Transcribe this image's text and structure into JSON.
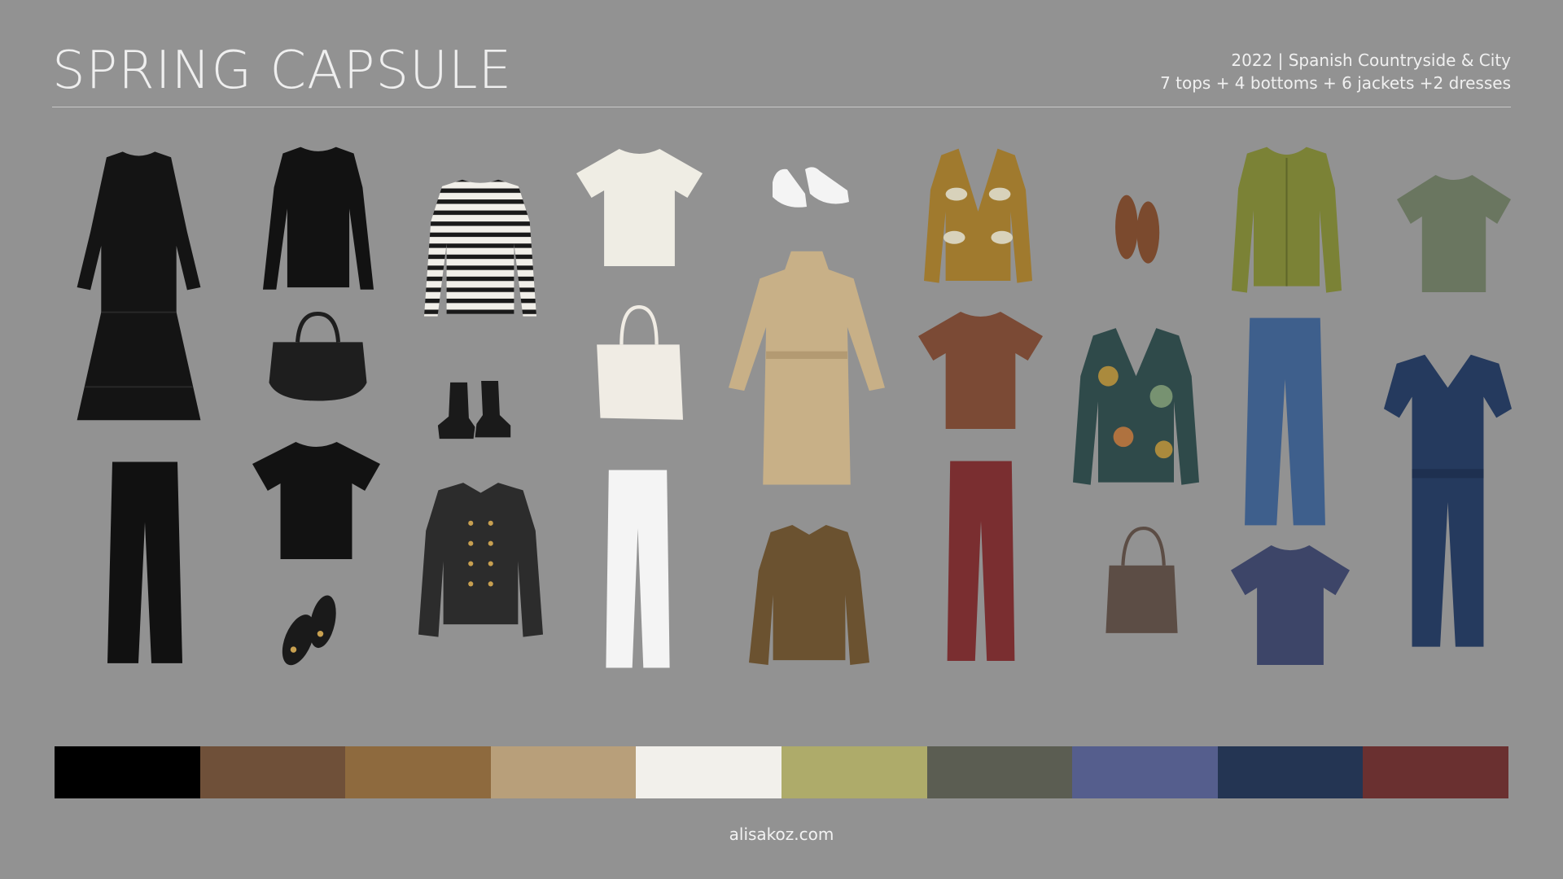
{
  "header": {
    "title": "SPRING CAPSULE",
    "subtitle_line1": "2022 | Spanish Countryside & City",
    "subtitle_line2": "7 tops + 4 bottoms + 6 jackets +2  dresses"
  },
  "items": [
    {
      "name": "black-dress-icon",
      "color": "#141414"
    },
    {
      "name": "black-pants-icon",
      "color": "#111111"
    },
    {
      "name": "black-longsleeve-top-icon",
      "color": "#121212"
    },
    {
      "name": "black-tote-bag-icon",
      "color": "#1e1e1e"
    },
    {
      "name": "black-tshirt-icon",
      "color": "#121212"
    },
    {
      "name": "black-loafers-icon",
      "color": "#1a1a1a"
    },
    {
      "name": "striped-longsleeve-top-icon",
      "color": "#f1efe9"
    },
    {
      "name": "black-ankle-boots-icon",
      "color": "#1a1a1a"
    },
    {
      "name": "military-jacket-icon",
      "color": "#2c2c2c"
    },
    {
      "name": "cream-tshirt-icon",
      "color": "#efede4"
    },
    {
      "name": "canvas-tote-bag-icon",
      "color": "#f0ece4"
    },
    {
      "name": "white-jeans-icon",
      "color": "#f4f4f4"
    },
    {
      "name": "white-sneakers-icon",
      "color": "#f4f4f4"
    },
    {
      "name": "trench-coat-icon",
      "color": "#c8b087"
    },
    {
      "name": "olive-shirt-jacket-icon",
      "color": "#6b5230"
    },
    {
      "name": "patterned-cardigan-icon",
      "color": "#a07a2e"
    },
    {
      "name": "brown-tshirt-icon",
      "color": "#7b4a35"
    },
    {
      "name": "burgundy-trousers-icon",
      "color": "#7a2e30"
    },
    {
      "name": "brown-tassel-loafers-icon",
      "color": "#7b4a2e"
    },
    {
      "name": "tropical-print-jacket-icon",
      "color": "#2f4a4a"
    },
    {
      "name": "brown-bucket-bag-icon",
      "color": "#5c4d45"
    },
    {
      "name": "green-knit-cardigan-icon",
      "color": "#7b8236"
    },
    {
      "name": "blue-jeans-icon",
      "color": "#3e5f8c"
    },
    {
      "name": "navy-tshirt-icon",
      "color": "#3d4568"
    },
    {
      "name": "sage-tshirt-icon",
      "color": "#6a7660"
    },
    {
      "name": "navy-jumpsuit-icon",
      "color": "#253a5e"
    }
  ],
  "palette": [
    "#000000",
    "#6f5039",
    "#8e6a3e",
    "#b89f7a",
    "#f2f0eb",
    "#aeab6a",
    "#5b5d52",
    "#555e8d",
    "#243553",
    "#6a3030"
  ],
  "footer": {
    "website": "alisakoz.com"
  }
}
